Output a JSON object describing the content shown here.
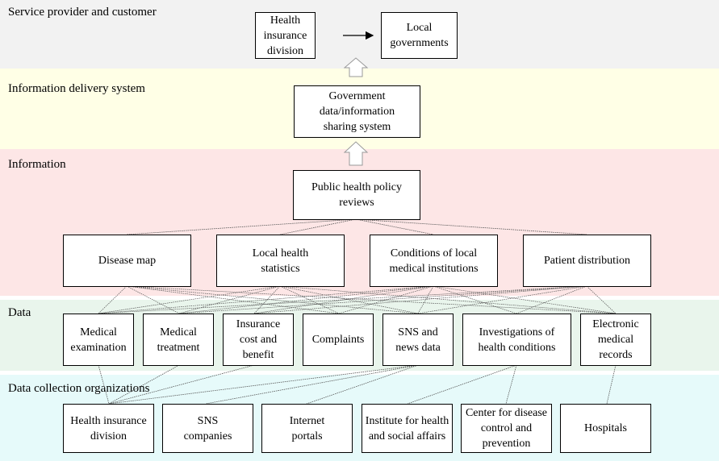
{
  "layers": {
    "provider": {
      "label": "Service provider and customer",
      "color": "#f2f2f2",
      "boxes": [
        "Health insurance division",
        "Local governments"
      ]
    },
    "delivery": {
      "label": "Information delivery system",
      "color": "#ffffe6",
      "boxes": [
        "Government data/information sharing system"
      ]
    },
    "information": {
      "label": "Information",
      "color": "#fde6e6",
      "top": "Public health policy reviews",
      "boxes": [
        "Disease map",
        "Local health statistics",
        "Conditions of local medical institutions",
        "Patient distribution"
      ]
    },
    "data": {
      "label": "Data",
      "color": "#e9f5ec",
      "boxes": [
        "Medical examination",
        "Medical treatment",
        "Insurance cost and benefit",
        "Complaints",
        "SNS and news data",
        "Investigations of health conditions",
        "Electronic medical records"
      ]
    },
    "orgs": {
      "label": "Data collection organizations",
      "color": "#e6fafa",
      "boxes": [
        "Health insurance division",
        "SNS companies",
        "Internet portals",
        "Institute for health and social affairs",
        "Center for disease control and prevention",
        "Hospitals"
      ]
    }
  }
}
